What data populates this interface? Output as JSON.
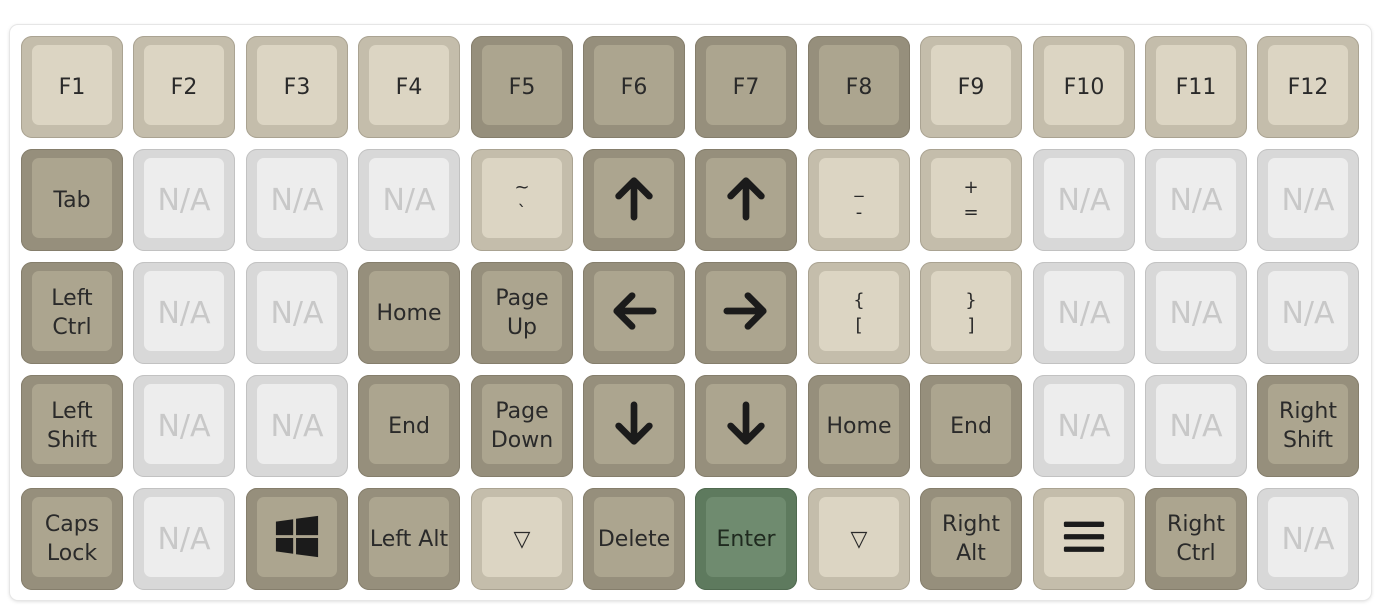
{
  "colors": {
    "light_key": "#dcd5c3",
    "dark_key": "#aca58f",
    "unassigned_key": "#ededed",
    "enter_key": "#6f8b6f"
  },
  "rows": [
    [
      {
        "label": "F1",
        "style": "light"
      },
      {
        "label": "F2",
        "style": "light"
      },
      {
        "label": "F3",
        "style": "light"
      },
      {
        "label": "F4",
        "style": "light"
      },
      {
        "label": "F5",
        "style": "dark"
      },
      {
        "label": "F6",
        "style": "dark"
      },
      {
        "label": "F7",
        "style": "dark"
      },
      {
        "label": "F8",
        "style": "dark"
      },
      {
        "label": "F9",
        "style": "light"
      },
      {
        "label": "F10",
        "style": "light"
      },
      {
        "label": "F11",
        "style": "light"
      },
      {
        "label": "F12",
        "style": "light"
      }
    ],
    [
      {
        "label": "Tab",
        "style": "dark"
      },
      {
        "label": "N/A",
        "style": "na"
      },
      {
        "label": "N/A",
        "style": "na"
      },
      {
        "label": "N/A",
        "style": "na"
      },
      {
        "label": "~\n`",
        "style": "light"
      },
      {
        "icon": "arrow-up-icon",
        "style": "dark"
      },
      {
        "icon": "arrow-up-icon",
        "style": "dark"
      },
      {
        "label": "_\n-",
        "style": "light"
      },
      {
        "label": "+\n=",
        "style": "light"
      },
      {
        "label": "N/A",
        "style": "na"
      },
      {
        "label": "N/A",
        "style": "na"
      },
      {
        "label": "N/A",
        "style": "na"
      }
    ],
    [
      {
        "label": "Left\nCtrl",
        "style": "dark"
      },
      {
        "label": "N/A",
        "style": "na"
      },
      {
        "label": "N/A",
        "style": "na"
      },
      {
        "label": "Home",
        "style": "dark"
      },
      {
        "label": "Page\nUp",
        "style": "dark"
      },
      {
        "icon": "arrow-left-icon",
        "style": "dark"
      },
      {
        "icon": "arrow-right-icon",
        "style": "dark"
      },
      {
        "label": "{\n[",
        "style": "light"
      },
      {
        "label": "}\n]",
        "style": "light"
      },
      {
        "label": "N/A",
        "style": "na"
      },
      {
        "label": "N/A",
        "style": "na"
      },
      {
        "label": "N/A",
        "style": "na"
      }
    ],
    [
      {
        "label": "Left\nShift",
        "style": "dark"
      },
      {
        "label": "N/A",
        "style": "na"
      },
      {
        "label": "N/A",
        "style": "na"
      },
      {
        "label": "End",
        "style": "dark"
      },
      {
        "label": "Page\nDown",
        "style": "dark"
      },
      {
        "icon": "arrow-down-icon",
        "style": "dark"
      },
      {
        "icon": "arrow-down-icon",
        "style": "dark"
      },
      {
        "label": "Home",
        "style": "dark"
      },
      {
        "label": "End",
        "style": "dark"
      },
      {
        "label": "N/A",
        "style": "na"
      },
      {
        "label": "N/A",
        "style": "na"
      },
      {
        "label": "Right\nShift",
        "style": "dark"
      }
    ],
    [
      {
        "label": "Caps\nLock",
        "style": "dark"
      },
      {
        "label": "N/A",
        "style": "na"
      },
      {
        "icon": "windows-icon",
        "style": "dark"
      },
      {
        "label": "Left Alt",
        "style": "dark"
      },
      {
        "label": "▽",
        "style": "light"
      },
      {
        "label": "Delete",
        "style": "dark"
      },
      {
        "label": "Enter",
        "style": "green"
      },
      {
        "label": "▽",
        "style": "light"
      },
      {
        "label": "Right\nAlt",
        "style": "dark"
      },
      {
        "icon": "menu-icon",
        "style": "light"
      },
      {
        "label": "Right\nCtrl",
        "style": "dark"
      },
      {
        "label": "N/A",
        "style": "na"
      }
    ]
  ]
}
